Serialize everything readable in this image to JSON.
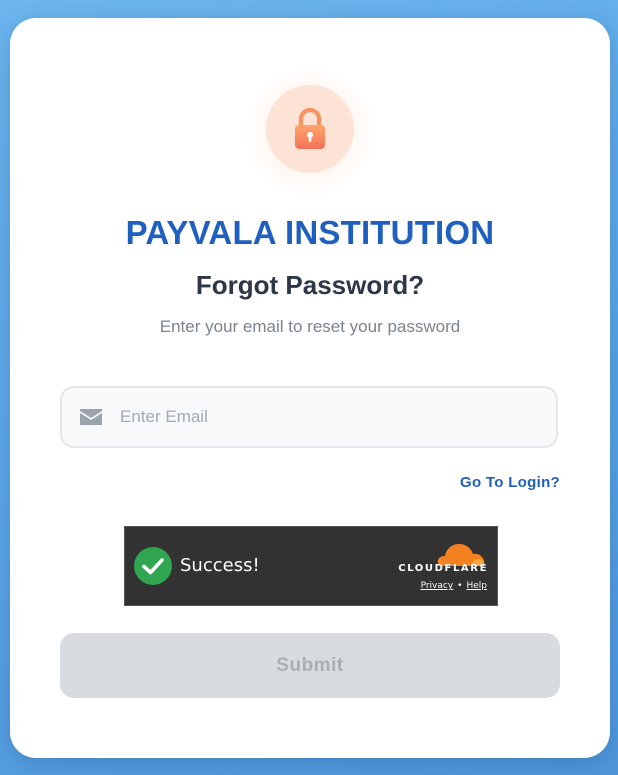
{
  "brand": {
    "name": "PAYVALA INSTITUTION",
    "color": "#1f5fbf"
  },
  "header": {
    "title": "Forgot Password?",
    "subtitle": "Enter your email to reset your password",
    "icon": "lock-icon"
  },
  "form": {
    "email": {
      "value": "",
      "placeholder": "Enter Email",
      "icon": "envelope-icon"
    },
    "login_link": "Go To Login?",
    "submit_label": "Submit"
  },
  "captcha": {
    "status": "Success!",
    "provider": "CLOUDFLARE",
    "privacy_label": "Privacy",
    "help_label": "Help",
    "separator": "•",
    "check_icon": "checkmark-icon",
    "logo_icon": "cloudflare-cloud-icon",
    "success_color": "#2fa64f",
    "logo_color": "#f48120"
  },
  "colors": {
    "background": "#5aa6e6",
    "submit_disabled": "#d8dce0",
    "lock_accent": "#f7855f"
  }
}
